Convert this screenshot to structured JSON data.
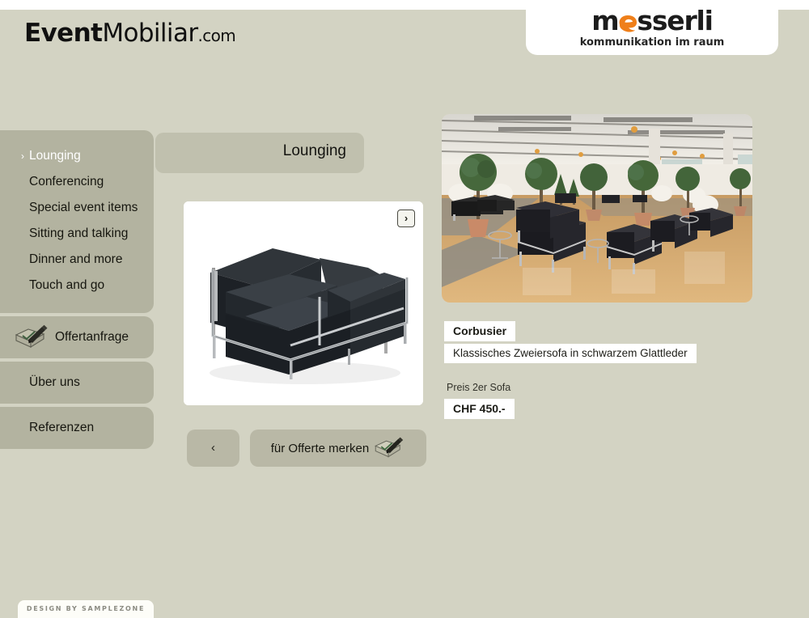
{
  "site": {
    "logo_bold": "Event",
    "logo_light": "Mobiliar",
    "logo_tld": ".com"
  },
  "partner_logo": {
    "wordmark_prefix": "m",
    "wordmark_suffix": "sserli",
    "tagline": "kommunikation im raum",
    "accent_color": "#ef7f1a",
    "text_color": "#1c1c1c",
    "e_icon": "orange-blob-e-icon"
  },
  "sidebar": {
    "categories": [
      {
        "label": "Lounging",
        "active": true,
        "chevron": "›"
      },
      {
        "label": "Conferencing",
        "active": false
      },
      {
        "label": "Special event items",
        "active": false
      },
      {
        "label": "Sitting and talking",
        "active": false
      },
      {
        "label": "Dinner and more",
        "active": false
      },
      {
        "label": "Touch and go",
        "active": false
      }
    ],
    "offer_request": {
      "label": "Offertanfrage",
      "icon": "pen-notepad-icon"
    },
    "about": {
      "label": "Über uns"
    },
    "references": {
      "label": "Referenzen"
    }
  },
  "main": {
    "section_title": "Lounging",
    "next_button_glyph": "›",
    "prev_button_glyph": "‹",
    "remember_button": {
      "label": "für Offerte merken",
      "icon": "pen-notepad-icon"
    },
    "product_image_alt": "black-corbusier-lc2-two-seater-sofa"
  },
  "product": {
    "name": "Corbusier",
    "description": "Klassisches Zweiersofa in schwarzem Glattleder",
    "price_label": "Preis 2er Sofa",
    "price_value": "CHF 450.-"
  },
  "hero": {
    "image_alt": "event-hall-with-black-leather-lounge-furniture-and-topiary-trees"
  },
  "footer": {
    "credit": "DESIGN BY SAMPLEZONE"
  },
  "colors": {
    "page_background": "#d3d3c3",
    "sidebar_block": "#b3b3a0",
    "title_bar": "#c0c0ae",
    "button": "#b9b8a6",
    "card_white": "#ffffff",
    "accent_orange": "#ef7f1a"
  }
}
